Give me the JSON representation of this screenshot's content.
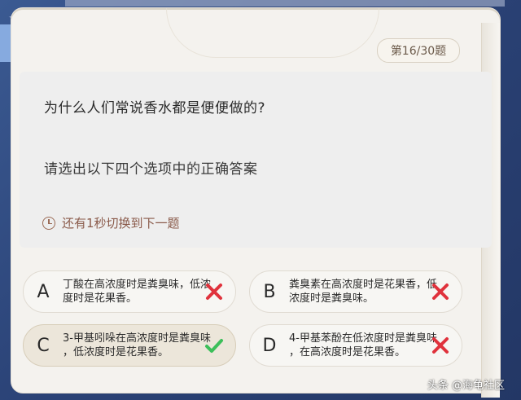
{
  "quiz": {
    "counter": "第16/30题",
    "question": "为什么人们常说香水都是便便做的?",
    "instruction": "请选出以下四个选项中的正确答案",
    "timer_text": "还有1秒切换到下一题"
  },
  "options": [
    {
      "letter": "A",
      "line1": "丁酸在高浓度时是粪臭味，低浓",
      "line2": "度时是花果香。",
      "result": "wrong"
    },
    {
      "letter": "B",
      "line1": "粪臭素在高浓度时是花果香，低",
      "line2": "浓度时是粪臭味。",
      "result": "wrong"
    },
    {
      "letter": "C",
      "line1": "3-甲基吲哚在高浓度时是粪臭味",
      "line2": "，低浓度时是花果香。",
      "result": "correct"
    },
    {
      "letter": "D",
      "line1": "4-甲基苯酚在低浓度时是粪臭味",
      "line2": "，在高浓度时是花果香。",
      "result": "wrong"
    }
  ],
  "colors": {
    "wrong": "#e0323c",
    "correct": "#3cbf5a",
    "card": "#f4f2ee"
  },
  "watermark": "头条 @海龟社区"
}
